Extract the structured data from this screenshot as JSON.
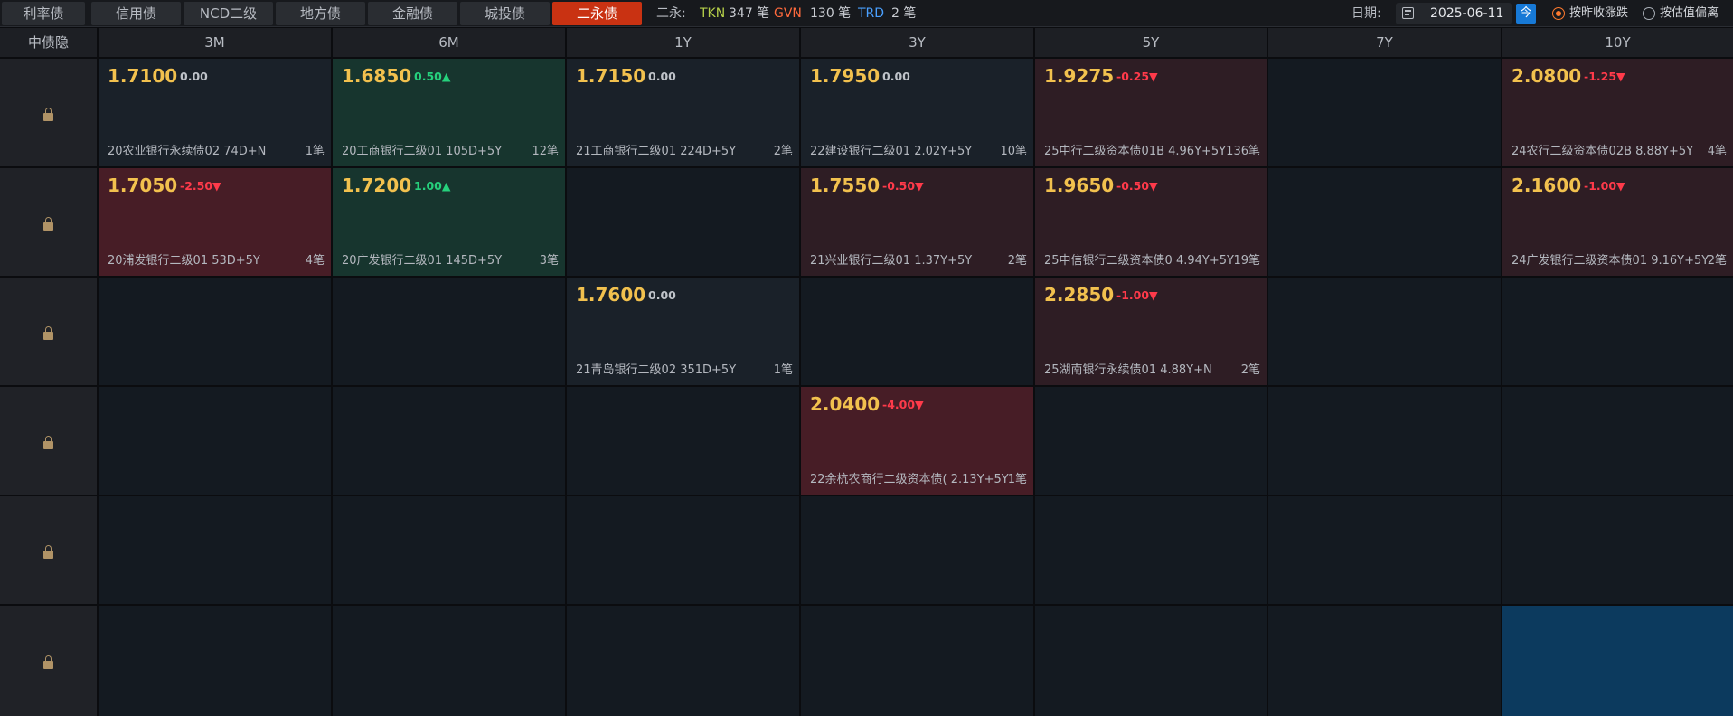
{
  "tabs": [
    {
      "label": "利率债",
      "active": false
    },
    {
      "label": "信用债",
      "active": false
    },
    {
      "label": "NCD二级",
      "active": false
    },
    {
      "label": "地方债",
      "active": false
    },
    {
      "label": "金融债",
      "active": false
    },
    {
      "label": "城投债",
      "active": false
    },
    {
      "label": "二永债",
      "active": true
    }
  ],
  "stats": {
    "prefix": "二永:",
    "tkn_label": "TKN",
    "tkn_count": "347 笔",
    "gvn_label": "GVN",
    "gvn_count": "130 笔",
    "trd_label": "TRD",
    "trd_count": "2 笔"
  },
  "date": {
    "label": "日期:",
    "value": "2025-06-11",
    "today_label": "今"
  },
  "options": [
    {
      "label": "按昨收涨跌",
      "selected": true
    },
    {
      "label": "按估值偏离",
      "selected": false
    }
  ],
  "columns": [
    "中债隐",
    "3M",
    "6M",
    "1Y",
    "3Y",
    "5Y",
    "7Y",
    "10Y"
  ],
  "colors": {
    "accent": "#c93212",
    "yield": "#f2c14e",
    "up": "#26d07c",
    "down": "#ff3a4a",
    "select": "#0c3a5e"
  },
  "rows": [
    {
      "cells": [
        {
          "yield": "1.7100",
          "change": "0.00",
          "trend": "flat",
          "bond": "20农业银行永续债02 74D+N",
          "count": "1笔"
        },
        {
          "yield": "1.6850",
          "change": "0.50▲",
          "trend": "up",
          "bond": "20工商银行二级01 105D+5Y",
          "count": "12笔"
        },
        {
          "yield": "1.7150",
          "change": "0.00",
          "trend": "flat",
          "bond": "21工商银行二级01 224D+5Y",
          "count": "2笔"
        },
        {
          "yield": "1.7950",
          "change": "0.00",
          "trend": "flat",
          "bond": "22建设银行二级01 2.02Y+5Y",
          "count": "10笔"
        },
        {
          "yield": "1.9275",
          "change": "-0.25▼",
          "trend": "down",
          "bond": "25中行二级资本债01B 4.96Y+5Y",
          "count": "136笔"
        },
        null,
        {
          "yield": "2.0800",
          "change": "-1.25▼",
          "trend": "down",
          "bond": "24农行二级资本债02B 8.88Y+5Y",
          "count": "4笔"
        }
      ]
    },
    {
      "cells": [
        {
          "yield": "1.7050",
          "change": "-2.50▼",
          "trend": "down-strong",
          "bond": "20浦发银行二级01 53D+5Y",
          "count": "4笔"
        },
        {
          "yield": "1.7200",
          "change": "1.00▲",
          "trend": "up",
          "bond": "20广发银行二级01 145D+5Y",
          "count": "3笔"
        },
        null,
        {
          "yield": "1.7550",
          "change": "-0.50▼",
          "trend": "down",
          "bond": "21兴业银行二级01 1.37Y+5Y",
          "count": "2笔"
        },
        {
          "yield": "1.9650",
          "change": "-0.50▼",
          "trend": "down",
          "bond": "25中信银行二级资本债0 4.94Y+5Y",
          "count": "19笔"
        },
        null,
        {
          "yield": "2.1600",
          "change": "-1.00▼",
          "trend": "down",
          "bond": "24广发银行二级资本债01 9.16Y+5Y",
          "count": "2笔"
        }
      ]
    },
    {
      "cells": [
        null,
        null,
        {
          "yield": "1.7600",
          "change": "0.00",
          "trend": "flat",
          "bond": "21青岛银行二级02 351D+5Y",
          "count": "1笔"
        },
        null,
        {
          "yield": "2.2850",
          "change": "-1.00▼",
          "trend": "down",
          "bond": "25湖南银行永续债01 4.88Y+N",
          "count": "2笔"
        },
        null,
        null
      ]
    },
    {
      "cells": [
        null,
        null,
        null,
        {
          "yield": "2.0400",
          "change": "-4.00▼",
          "trend": "down-strong",
          "bond": "22余杭农商行二级资本债( 2.13Y+5Y",
          "count": "1笔"
        },
        null,
        null,
        null
      ]
    },
    {
      "cells": [
        null,
        null,
        null,
        null,
        null,
        null,
        null
      ]
    },
    {
      "cells": [
        null,
        null,
        null,
        null,
        null,
        null,
        {
          "selected": true
        }
      ]
    }
  ]
}
